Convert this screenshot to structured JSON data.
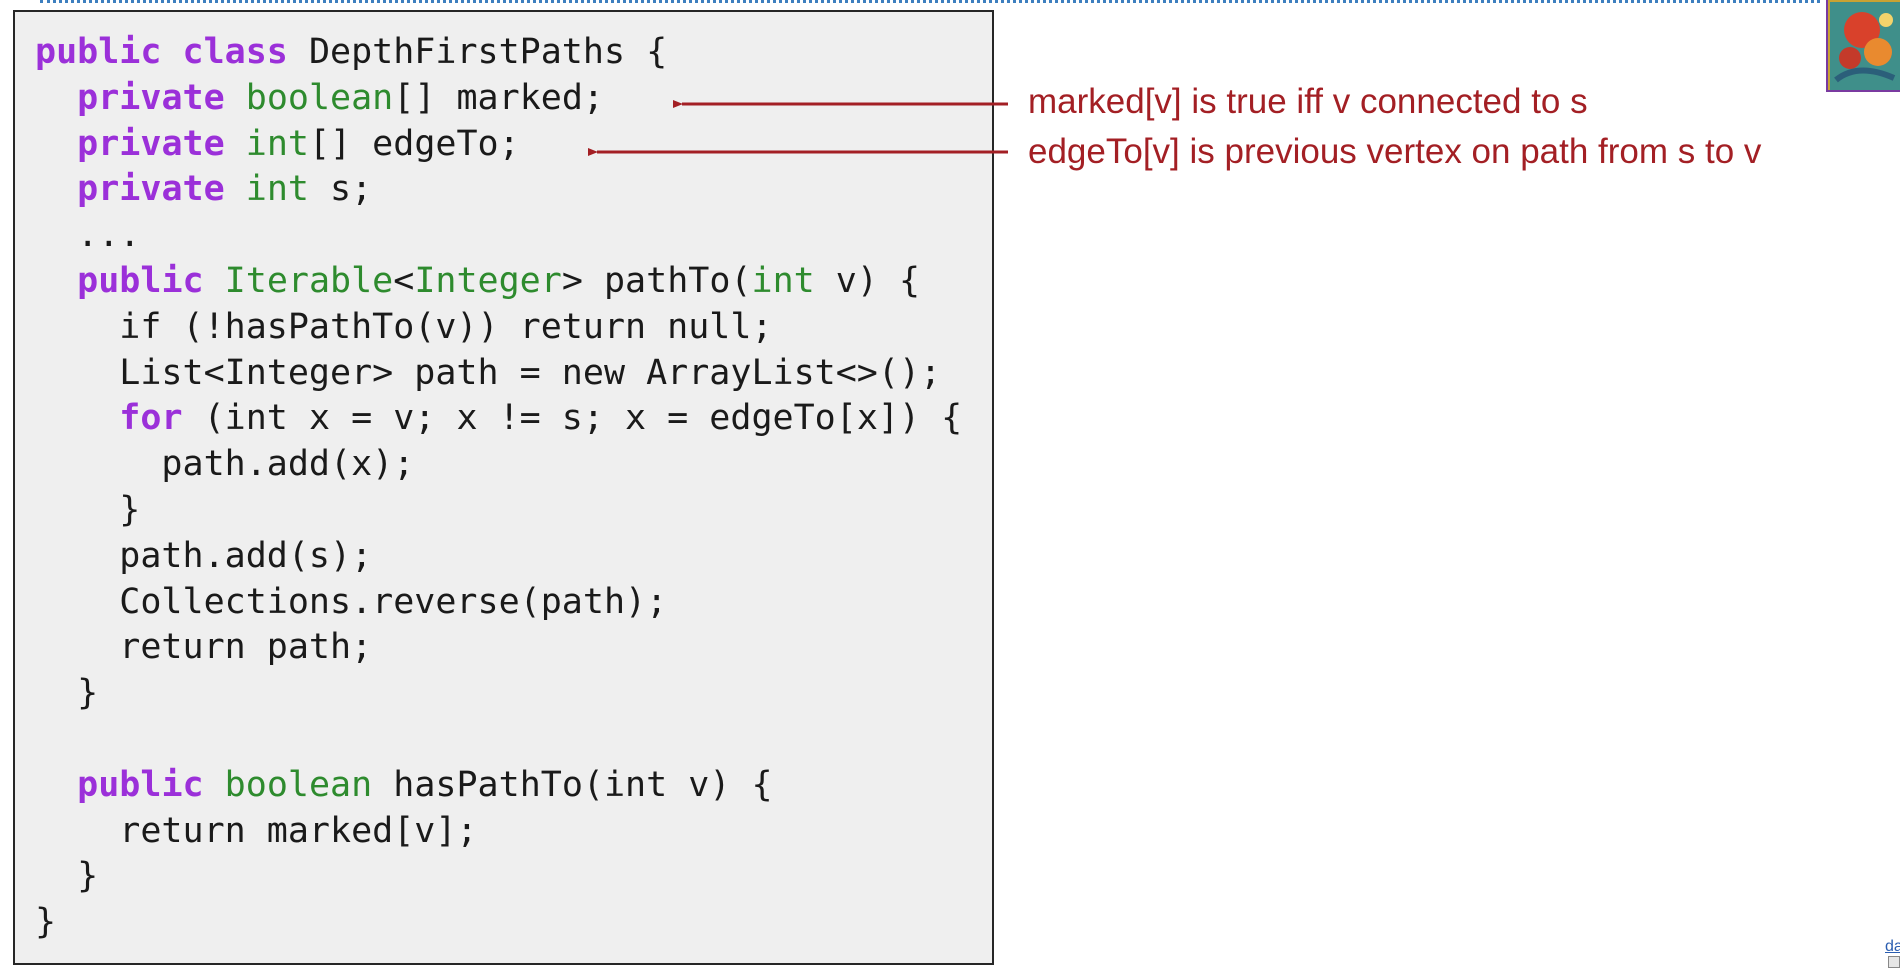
{
  "code_lines": [
    [
      {
        "t": "public class",
        "c": "kw"
      },
      {
        "t": " DepthFirstPaths {",
        "c": ""
      }
    ],
    [
      {
        "t": "  ",
        "c": ""
      },
      {
        "t": "private",
        "c": "kw"
      },
      {
        "t": " ",
        "c": ""
      },
      {
        "t": "boolean",
        "c": "ty"
      },
      {
        "t": "[] marked;",
        "c": ""
      }
    ],
    [
      {
        "t": "  ",
        "c": ""
      },
      {
        "t": "private",
        "c": "kw"
      },
      {
        "t": " ",
        "c": ""
      },
      {
        "t": "int",
        "c": "ty"
      },
      {
        "t": "[] edgeTo;",
        "c": ""
      }
    ],
    [
      {
        "t": "  ",
        "c": ""
      },
      {
        "t": "private",
        "c": "kw"
      },
      {
        "t": " ",
        "c": ""
      },
      {
        "t": "int",
        "c": "ty"
      },
      {
        "t": " s;",
        "c": ""
      }
    ],
    [
      {
        "t": "  ...",
        "c": ""
      }
    ],
    [
      {
        "t": "  ",
        "c": ""
      },
      {
        "t": "public",
        "c": "kw"
      },
      {
        "t": " ",
        "c": ""
      },
      {
        "t": "Iterable",
        "c": "ty"
      },
      {
        "t": "<",
        "c": ""
      },
      {
        "t": "Integer",
        "c": "ty"
      },
      {
        "t": "> pathTo(",
        "c": ""
      },
      {
        "t": "int",
        "c": "ty"
      },
      {
        "t": " v) {",
        "c": ""
      }
    ],
    [
      {
        "t": "    if (!hasPathTo(v)) return null;",
        "c": ""
      }
    ],
    [
      {
        "t": "    List<Integer> path = new ArrayList<>();",
        "c": ""
      }
    ],
    [
      {
        "t": "    ",
        "c": ""
      },
      {
        "t": "for",
        "c": "kw"
      },
      {
        "t": " (int x = v; x != s; x = edgeTo[x]) {",
        "c": ""
      }
    ],
    [
      {
        "t": "      path.add(x);",
        "c": ""
      }
    ],
    [
      {
        "t": "    }",
        "c": ""
      }
    ],
    [
      {
        "t": "    path.add(s);",
        "c": ""
      }
    ],
    [
      {
        "t": "    Collections.reverse(path);",
        "c": ""
      }
    ],
    [
      {
        "t": "    return path;",
        "c": ""
      }
    ],
    [
      {
        "t": "  }",
        "c": ""
      }
    ],
    [
      {
        "t": "",
        "c": ""
      }
    ],
    [
      {
        "t": "  ",
        "c": ""
      },
      {
        "t": "public",
        "c": "kw"
      },
      {
        "t": " ",
        "c": ""
      },
      {
        "t": "boolean",
        "c": "ty"
      },
      {
        "t": " hasPathTo(int v) {",
        "c": ""
      }
    ],
    [
      {
        "t": "    return marked[v];",
        "c": ""
      }
    ],
    [
      {
        "t": "  }",
        "c": ""
      }
    ],
    [
      {
        "t": "}",
        "c": ""
      }
    ]
  ],
  "annotations": {
    "marked": "marked[v] is true iff v connected to s",
    "edgeTo": "edgeTo[v] is previous vertex on path from s to v"
  },
  "corner_link": "da",
  "colors": {
    "keyword": "#9b30d9",
    "type": "#2e8b2e",
    "annotation": "#a31f24",
    "code_background": "#efefef"
  }
}
